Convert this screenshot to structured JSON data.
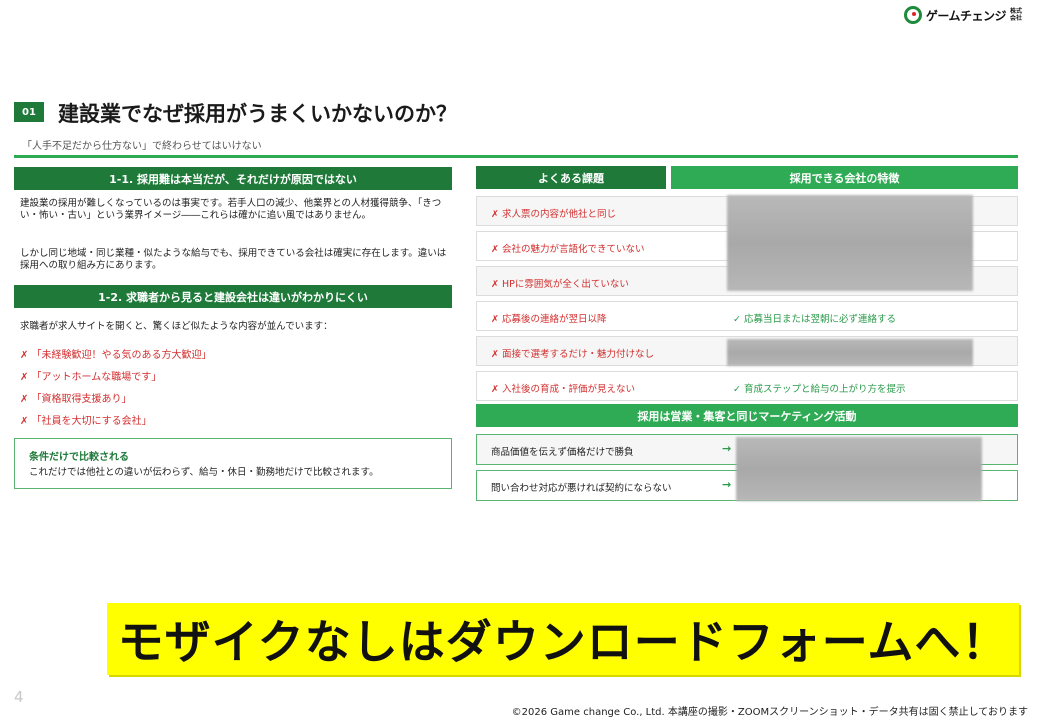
{
  "logo": {
    "name": "ゲームチェンジ",
    "suffix": "株式会社"
  },
  "header": {
    "number": "01",
    "title": "建設業でなぜ採用がうまくいかないのか？",
    "subtitle": "「人手不足だから仕方ない」で終わらせてはいけない"
  },
  "left": {
    "section1": {
      "title": "1-1. 採用難は本当だが、それだけが原因ではない",
      "paragraph1": "建設業の採用が難しくなっているのは事実です。若手人口の減少、他業界との人材獲得競争、「きつい・怖い・古い」という業界イメージ――これらは確かに追い風ではありません。",
      "paragraph2": "しかし同じ地域・同じ業種・似たような給与でも、採用できている会社は確実に存在します。違いは採用への取り組み方にあります。"
    },
    "section2": {
      "title": "1-2. 求職者から見ると建設会社は違いがわかりにくい",
      "intro": "求職者が求人サイトを開くと、驚くほど似たような内容が並んでいます：",
      "items": [
        "✗ 「未経験歓迎！やる気のある方大歓迎」",
        "✗ 「アットホームな職場です」",
        "✗ 「資格取得支援あり」",
        "✗ 「社員を大切にする会社」"
      ]
    },
    "callout": {
      "title": "条件だけで比較される",
      "body": "これだけでは他社との違いが伝わらず、給与・休日・勤務地だけで比較されます。"
    }
  },
  "right": {
    "col1_header": "よくある課題",
    "col2_header": "採用できる会社の特徴",
    "rows": [
      {
        "problem": "✗ 求人票の内容が他社と同じ",
        "solution": ""
      },
      {
        "problem": "✗ 会社の魅力が言語化できていない",
        "solution": ""
      },
      {
        "problem": "✗ HPに雰囲気が全く出ていない",
        "solution": ""
      },
      {
        "problem": "✗ 応募後の連絡が翌日以降",
        "solution": "✓ 応募当日または翌朝に必ず連絡する"
      },
      {
        "problem": "✗ 面接で選考するだけ・魅力付けなし",
        "solution": ""
      },
      {
        "problem": "✗ 入社後の育成・評価が見えない",
        "solution": "✓ 育成ステップと給与の上がり方を提示"
      }
    ],
    "marketing_header": "採用は営業・集客と同じマーケティング活動",
    "marketing_rows": [
      {
        "left": "商品価値を伝えず価格だけで勝負",
        "arrow": "→"
      },
      {
        "left": "問い合わせ対応が悪ければ契約にならない",
        "arrow": "→"
      }
    ]
  },
  "cta": {
    "text": "モザイクなしはダウンロードフォームへ！"
  },
  "footer": {
    "page": "4",
    "copyright": "©2026 Game change Co., Ltd. 本講座の撮影・ZOOMスクリーンショット・データ共有は固く禁止しております"
  }
}
